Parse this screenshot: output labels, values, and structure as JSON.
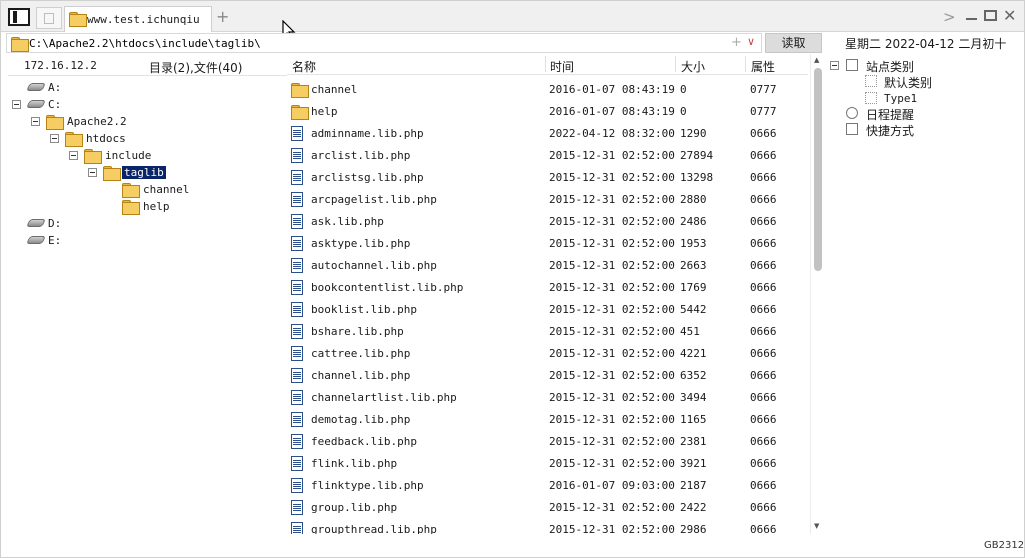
{
  "tabs": {
    "active_title": "www.test.ichunqiu"
  },
  "address_bar": {
    "path": "C:\\Apache2.2\\htdocs\\include\\taglib\\",
    "add_glyph": "+",
    "dropdown_glyph": "∨",
    "read_button": "读取"
  },
  "date_label": "星期二 2022-04-12 二月初十",
  "status": {
    "host": "172.16.12.2",
    "summary": "目录(2),文件(40)"
  },
  "tree": [
    {
      "label": "A:",
      "type": "drive"
    },
    {
      "label": "C:",
      "type": "drive"
    },
    {
      "label": "Apache2.2",
      "type": "folder"
    },
    {
      "label": "htdocs",
      "type": "folder"
    },
    {
      "label": "include",
      "type": "folder"
    },
    {
      "label": "taglib",
      "type": "folder",
      "selected": true
    },
    {
      "label": "channel",
      "type": "folder"
    },
    {
      "label": "help",
      "type": "folder"
    },
    {
      "label": "D:",
      "type": "drive"
    },
    {
      "label": "E:",
      "type": "drive"
    }
  ],
  "columns": {
    "name": "名称",
    "time": "时间",
    "size": "大小",
    "attr": "属性"
  },
  "files": [
    {
      "name": "channel",
      "type": "folder",
      "time": "2016-01-07 08:43:19",
      "size": "0",
      "attr": "0777"
    },
    {
      "name": "help",
      "type": "folder",
      "time": "2016-01-07 08:43:19",
      "size": "0",
      "attr": "0777"
    },
    {
      "name": "adminname.lib.php",
      "type": "php",
      "time": "2022-04-12 08:32:00",
      "size": "1290",
      "attr": "0666"
    },
    {
      "name": "arclist.lib.php",
      "type": "php",
      "time": "2015-12-31 02:52:00",
      "size": "27894",
      "attr": "0666"
    },
    {
      "name": "arclistsg.lib.php",
      "type": "php",
      "time": "2015-12-31 02:52:00",
      "size": "13298",
      "attr": "0666"
    },
    {
      "name": "arcpagelist.lib.php",
      "type": "php",
      "time": "2015-12-31 02:52:00",
      "size": "2880",
      "attr": "0666"
    },
    {
      "name": "ask.lib.php",
      "type": "php",
      "time": "2015-12-31 02:52:00",
      "size": "2486",
      "attr": "0666"
    },
    {
      "name": "asktype.lib.php",
      "type": "php",
      "time": "2015-12-31 02:52:00",
      "size": "1953",
      "attr": "0666"
    },
    {
      "name": "autochannel.lib.php",
      "type": "php",
      "time": "2015-12-31 02:52:00",
      "size": "2663",
      "attr": "0666"
    },
    {
      "name": "bookcontentlist.lib.php",
      "type": "php",
      "time": "2015-12-31 02:52:00",
      "size": "1769",
      "attr": "0666"
    },
    {
      "name": "booklist.lib.php",
      "type": "php",
      "time": "2015-12-31 02:52:00",
      "size": "5442",
      "attr": "0666"
    },
    {
      "name": "bshare.lib.php",
      "type": "php",
      "time": "2015-12-31 02:52:00",
      "size": "451",
      "attr": "0666"
    },
    {
      "name": "cattree.lib.php",
      "type": "php",
      "time": "2015-12-31 02:52:00",
      "size": "4221",
      "attr": "0666"
    },
    {
      "name": "channel.lib.php",
      "type": "php",
      "time": "2015-12-31 02:52:00",
      "size": "6352",
      "attr": "0666"
    },
    {
      "name": "channelartlist.lib.php",
      "type": "php",
      "time": "2015-12-31 02:52:00",
      "size": "3494",
      "attr": "0666"
    },
    {
      "name": "demotag.lib.php",
      "type": "php",
      "time": "2015-12-31 02:52:00",
      "size": "1165",
      "attr": "0666"
    },
    {
      "name": "feedback.lib.php",
      "type": "php",
      "time": "2015-12-31 02:52:00",
      "size": "2381",
      "attr": "0666"
    },
    {
      "name": "flink.lib.php",
      "type": "php",
      "time": "2015-12-31 02:52:00",
      "size": "3921",
      "attr": "0666"
    },
    {
      "name": "flinktype.lib.php",
      "type": "php",
      "time": "2016-01-07 09:03:00",
      "size": "2187",
      "attr": "0666"
    },
    {
      "name": "group.lib.php",
      "type": "php",
      "time": "2015-12-31 02:52:00",
      "size": "2422",
      "attr": "0666"
    },
    {
      "name": "groupthread.lib.php",
      "type": "php",
      "time": "2015-12-31 02:52:00",
      "size": "2986",
      "attr": "0666"
    }
  ],
  "scrollbar": {
    "visible_fraction": 0.45
  },
  "right_panel": {
    "root": "站点类别",
    "default_category": "默认类别",
    "type1": "Type1",
    "reminder": "日程提醒",
    "shortcut": "快捷方式"
  },
  "encoding": "GB2312",
  "colors": {
    "selection": "#0a246a",
    "folder": "#f6cd63",
    "read_button": "#dcdcdc"
  }
}
